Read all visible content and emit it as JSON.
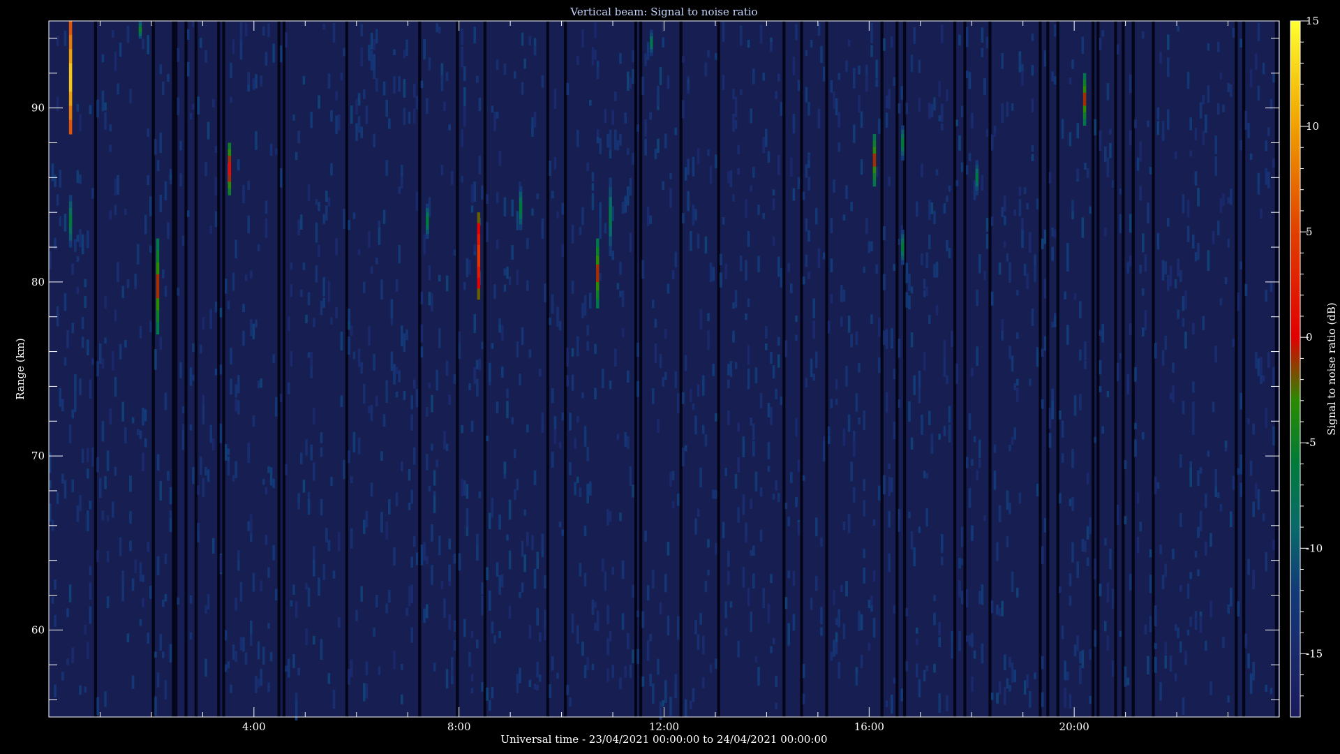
{
  "chart_data": {
    "type": "heatmap",
    "title": "Vertical beam: Signal to noise ratio",
    "xlabel": "Universal time - 23/04/2021 00:00:00 to 24/04/2021 00:00:00",
    "ylabel": "Range (km)",
    "colorbar_label": "Signal to noise ratio (dB)",
    "xlim_hours": [
      0,
      24
    ],
    "ylim_km": [
      55,
      95
    ],
    "clim_db": [
      -18,
      15
    ],
    "x_ticks": [
      {
        "value": 4,
        "label": "4:00"
      },
      {
        "value": 8,
        "label": "8:00"
      },
      {
        "value": 12,
        "label": "12:00"
      },
      {
        "value": 16,
        "label": "16:00"
      },
      {
        "value": 20,
        "label": "20:00"
      }
    ],
    "y_ticks": [
      {
        "value": 60,
        "label": "60"
      },
      {
        "value": 70,
        "label": "70"
      },
      {
        "value": 80,
        "label": "80"
      },
      {
        "value": 90,
        "label": "90"
      }
    ],
    "colorbar_ticks": [
      {
        "value": 15,
        "label": "15"
      },
      {
        "value": 10,
        "label": "10"
      },
      {
        "value": 5,
        "label": "5"
      },
      {
        "value": 0,
        "label": "0"
      },
      {
        "value": -5,
        "label": "-5"
      },
      {
        "value": -10,
        "label": "-10"
      },
      {
        "value": -15,
        "label": "-15"
      }
    ],
    "colormap": [
      {
        "db": -18,
        "color": "#1a1a5c"
      },
      {
        "db": -15,
        "color": "#1a2a6c"
      },
      {
        "db": -12,
        "color": "#123a78"
      },
      {
        "db": -9,
        "color": "#0a6a6a"
      },
      {
        "db": -6,
        "color": "#007a3a"
      },
      {
        "db": -3,
        "color": "#2a8a00"
      },
      {
        "db": 0,
        "color": "#e00000"
      },
      {
        "db": 5,
        "color": "#e04000"
      },
      {
        "db": 10,
        "color": "#f0a000"
      },
      {
        "db": 15,
        "color": "#ffff30"
      }
    ],
    "background_db": -14,
    "echoes": [
      {
        "time_h": 0.42,
        "range_km_start": 88.5,
        "range_km_end": 95.0,
        "peak_db": 13
      },
      {
        "time_h": 0.42,
        "range_km_start": 82.0,
        "range_km_end": 85.0,
        "peak_db": -5
      },
      {
        "time_h": 1.78,
        "range_km_start": 94.0,
        "range_km_end": 95.0,
        "peak_db": -4
      },
      {
        "time_h": 2.12,
        "range_km_start": 77.0,
        "range_km_end": 82.5,
        "peak_db": 0
      },
      {
        "time_h": 3.52,
        "range_km_start": 85.0,
        "range_km_end": 88.0,
        "peak_db": 2
      },
      {
        "time_h": 7.38,
        "range_km_start": 82.5,
        "range_km_end": 84.5,
        "peak_db": -5
      },
      {
        "time_h": 8.38,
        "range_km_start": 79.0,
        "range_km_end": 84.0,
        "peak_db": 5
      },
      {
        "time_h": 9.2,
        "range_km_start": 83.0,
        "range_km_end": 85.5,
        "peak_db": -5
      },
      {
        "time_h": 10.7,
        "range_km_start": 78.5,
        "range_km_end": 82.5,
        "peak_db": 0
      },
      {
        "time_h": 10.95,
        "range_km_start": 81.5,
        "range_km_end": 86.0,
        "peak_db": -6
      },
      {
        "time_h": 11.75,
        "range_km_start": 93.0,
        "range_km_end": 94.5,
        "peak_db": -6
      },
      {
        "time_h": 16.1,
        "range_km_start": 85.5,
        "range_km_end": 88.5,
        "peak_db": 0
      },
      {
        "time_h": 16.65,
        "range_km_start": 87.0,
        "range_km_end": 89.0,
        "peak_db": -5
      },
      {
        "time_h": 16.65,
        "range_km_start": 81.0,
        "range_km_end": 83.0,
        "peak_db": -5
      },
      {
        "time_h": 18.1,
        "range_km_start": 85.0,
        "range_km_end": 87.0,
        "peak_db": -6
      },
      {
        "time_h": 20.2,
        "range_km_start": 89.0,
        "range_km_end": 92.0,
        "peak_db": 0
      }
    ]
  }
}
